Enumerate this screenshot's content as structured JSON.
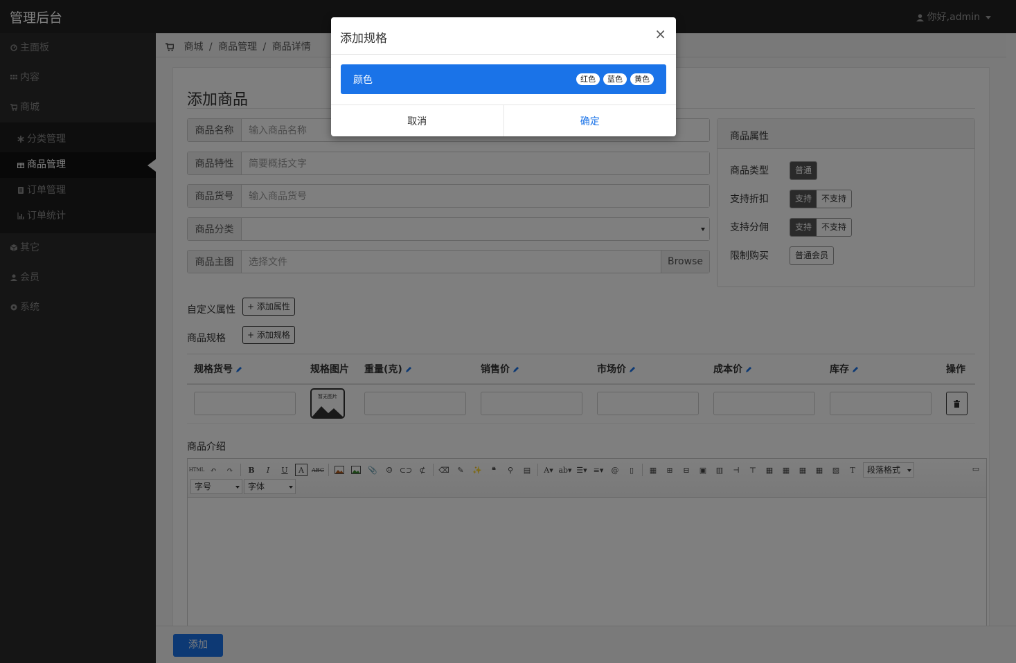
{
  "app": {
    "brand": "管理后台",
    "user": "你好,admin"
  },
  "sidebar": {
    "items": [
      {
        "label": "主面板",
        "icon": "dashboard-icon"
      },
      {
        "label": "内容",
        "icon": "grid-icon"
      },
      {
        "label": "商城",
        "icon": "cart-icon"
      },
      {
        "label": "其它",
        "icon": "cube-icon"
      },
      {
        "label": "会员",
        "icon": "user-icon"
      },
      {
        "label": "系统",
        "icon": "cog-icon"
      }
    ],
    "subitems": [
      {
        "label": "分类管理",
        "icon": "asterisk-icon"
      },
      {
        "label": "商品管理",
        "icon": "gift-icon"
      },
      {
        "label": "订单管理",
        "icon": "list-icon"
      },
      {
        "label": "订单统计",
        "icon": "stats-icon"
      }
    ]
  },
  "breadcrumb": [
    "商城",
    "/",
    "商品管理",
    "/",
    "商品详情"
  ],
  "form": {
    "title": "添加商品",
    "name": {
      "label": "商品名称",
      "placeholder": "输入商品名称"
    },
    "feature": {
      "label": "商品特性",
      "placeholder": "简要概括文字"
    },
    "sku": {
      "label": "商品货号",
      "placeholder": "输入商品货号"
    },
    "category": {
      "label": "商品分类",
      "value": ""
    },
    "image": {
      "label": "商品主图",
      "placeholder": "选择文件",
      "browse": "Browse"
    },
    "custom_attr_label": "自定义属性",
    "add_attr_button": "+ 添加属性",
    "spec_label": "商品规格",
    "add_spec_button": "+ 添加规格",
    "intro_label": "商品介绍",
    "submit": "添加"
  },
  "attributes": {
    "title": "商品属性",
    "type": {
      "label": "商品类型",
      "value": "普通"
    },
    "discount": {
      "label": "支持折扣",
      "options": [
        "支持",
        "不支持"
      ],
      "selected": "支持"
    },
    "commission": {
      "label": "支持分佣",
      "options": [
        "支持",
        "不支持"
      ],
      "selected": "支持"
    },
    "limit": {
      "label": "限制购买",
      "value": "普通会员"
    }
  },
  "spec_table": {
    "headers": [
      "规格货号",
      "规格图片",
      "重量(克)",
      "销售价",
      "市场价",
      "成本价",
      "库存",
      "操作"
    ],
    "no_image_text": "暂无图片"
  },
  "editor": {
    "paragraph_format": "段落格式",
    "font_size": "字号",
    "font_family": "字体"
  },
  "modal": {
    "title": "添加规格",
    "spec_name": "颜色",
    "tags": [
      "红色",
      "蓝色",
      "黄色"
    ],
    "cancel": "取消",
    "confirm": "确定"
  }
}
